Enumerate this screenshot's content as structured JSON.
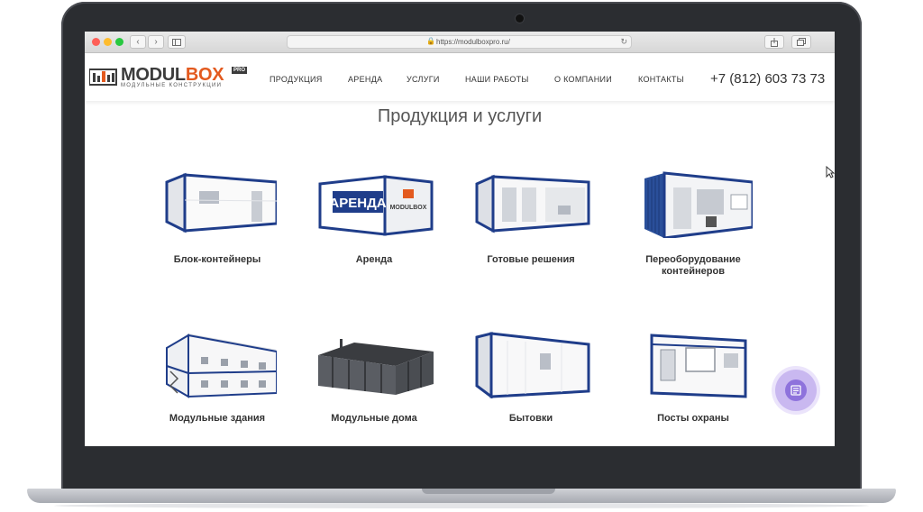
{
  "browser": {
    "url": "https://modulboxpro.ru/",
    "nav_back": "‹",
    "nav_forward": "›"
  },
  "header": {
    "logo": {
      "word_modul": "MODUL",
      "word_box": "BOX",
      "badge": "PRO",
      "subtitle": "МОДУЛЬНЫЕ КОНСТРУКЦИИ"
    },
    "menu": [
      "ПРОДУКЦИЯ",
      "АРЕНДА",
      "УСЛУГИ",
      "НАШИ РАБОТЫ",
      "О КОМПАНИИ",
      "КОНТАКТЫ"
    ],
    "phone": "+7 (812) 603 73 73"
  },
  "main": {
    "title": "Продукция и услуги",
    "products": [
      {
        "label": "Блок-контейнеры"
      },
      {
        "label": "Аренда",
        "image_text": "АРЕНДА",
        "image_brand": "MODULBOX"
      },
      {
        "label": "Готовые решения"
      },
      {
        "label": "Переоборудование контейнеров"
      },
      {
        "label": "Модульные здания"
      },
      {
        "label": "Модульные дома"
      },
      {
        "label": "Бытовки"
      },
      {
        "label": "Посты охраны"
      }
    ]
  },
  "colors": {
    "brand_orange": "#e35a1f",
    "container_blue": "#1f3d8a",
    "chat_purple": "#8e72dc"
  },
  "icons": [
    "lock-icon",
    "reload-icon",
    "share-icon",
    "tabs-icon",
    "sidebar-icon",
    "chat-icon",
    "cursor-icon"
  ]
}
